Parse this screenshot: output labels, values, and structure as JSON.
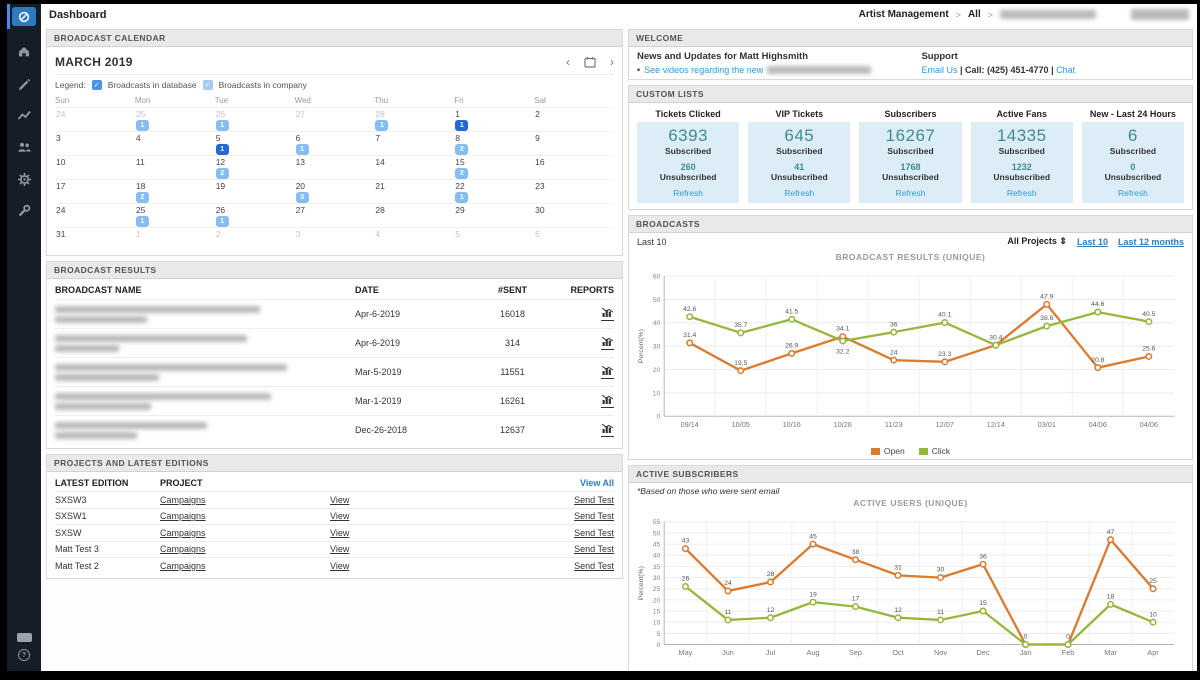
{
  "app": {
    "title": "Dashboard",
    "breadcrumb": [
      "Artist Management",
      "All"
    ]
  },
  "icons": {
    "crumb_sep": ">",
    "prev": "‹",
    "next": "›",
    "sort": "⇕",
    "bullet": "•",
    "check": "✓",
    "help": "?"
  },
  "sidebar": {
    "items": [
      "home",
      "edit",
      "reports",
      "users",
      "settings",
      "tools"
    ]
  },
  "calendar": {
    "header": "BROADCAST CALENDAR",
    "month": "MARCH 2019",
    "legend_label": "Legend:",
    "legend": [
      {
        "label": "Broadcasts in database"
      },
      {
        "label": "Broadcasts in company"
      }
    ],
    "day_names": [
      "Sun",
      "Mon",
      "Tue",
      "Wed",
      "Thu",
      "Fri",
      "Sat"
    ],
    "weeks": [
      [
        {
          "d": 24,
          "m": 1
        },
        {
          "d": 25,
          "m": 1,
          "b": 1
        },
        {
          "d": 26,
          "m": 1,
          "b": 1
        },
        {
          "d": 27,
          "m": 1
        },
        {
          "d": 28,
          "m": 1,
          "b": 1
        },
        {
          "d": 1,
          "b": 1,
          "dk": 1
        },
        {
          "d": 2
        }
      ],
      [
        {
          "d": 3
        },
        {
          "d": 4
        },
        {
          "d": 5,
          "b": 1,
          "dk": 1
        },
        {
          "d": 6,
          "b": 1
        },
        {
          "d": 7
        },
        {
          "d": 8,
          "b": 2
        },
        {
          "d": 9
        }
      ],
      [
        {
          "d": 10
        },
        {
          "d": 11
        },
        {
          "d": 12,
          "b": 2
        },
        {
          "d": 13
        },
        {
          "d": 14
        },
        {
          "d": 15,
          "b": 2
        },
        {
          "d": 16
        }
      ],
      [
        {
          "d": 17
        },
        {
          "d": 18,
          "b": 2
        },
        {
          "d": 19
        },
        {
          "d": 20,
          "b": 3
        },
        {
          "d": 21
        },
        {
          "d": 22,
          "b": 1
        },
        {
          "d": 23
        }
      ],
      [
        {
          "d": 24
        },
        {
          "d": 25,
          "b": 1
        },
        {
          "d": 26,
          "b": 1
        },
        {
          "d": 27
        },
        {
          "d": 28
        },
        {
          "d": 29
        },
        {
          "d": 30
        }
      ],
      [
        {
          "d": 31
        },
        {
          "d": 1,
          "m": 1
        },
        {
          "d": 2,
          "m": 1
        },
        {
          "d": 3,
          "m": 1
        },
        {
          "d": 4,
          "m": 1
        },
        {
          "d": 5,
          "m": 1
        },
        {
          "d": 6,
          "m": 1
        }
      ]
    ]
  },
  "broadcast_results": {
    "header": "BROADCAST RESULTS",
    "columns": [
      "BROADCAST NAME",
      "DATE",
      "#SENT",
      "REPORTS"
    ],
    "rows": [
      {
        "date": "Apr-6-2019",
        "sent": "16018"
      },
      {
        "date": "Apr-6-2019",
        "sent": "314"
      },
      {
        "date": "Mar-5-2019",
        "sent": "11551"
      },
      {
        "date": "Mar-1-2019",
        "sent": "16261"
      },
      {
        "date": "Dec-26-2018",
        "sent": "12637"
      }
    ]
  },
  "projects": {
    "header": "PROJECTS AND LATEST EDITIONS",
    "view_all": "View All",
    "columns": [
      "LATEST EDITION",
      "PROJECT"
    ],
    "rows": [
      {
        "edition": "SXSW3",
        "project": "Campaigns",
        "view": "View",
        "send": "Send Test"
      },
      {
        "edition": "SXSW1",
        "project": "Campaigns",
        "view": "View",
        "send": "Send Test"
      },
      {
        "edition": "SXSW",
        "project": "Campaigns",
        "view": "View",
        "send": "Send Test"
      },
      {
        "edition": "Matt Test 3",
        "project": "Campaigns",
        "view": "View",
        "send": "Send Test"
      },
      {
        "edition": "Matt Test 2",
        "project": "Campaigns",
        "view": "View",
        "send": "Send Test"
      }
    ]
  },
  "welcome": {
    "header": "WELCOME",
    "news_title": "News and Updates for Matt Highsmith",
    "news_link": "See videos regarding the new",
    "support_title": "Support",
    "email": "Email Us",
    "call": "Call: (425) 451-4770",
    "chat": "Chat",
    "sep": "|"
  },
  "custom_lists": {
    "header": "CUSTOM LISTS",
    "subscribed_label": "Subscribed",
    "unsubscribed_label": "Unsubscribed",
    "refresh_label": "Refresh",
    "cards": [
      {
        "title": "Tickets Clicked",
        "subscribed": "6393",
        "unsubscribed": "260"
      },
      {
        "title": "VIP Tickets",
        "subscribed": "645",
        "unsubscribed": "41"
      },
      {
        "title": "Subscribers",
        "subscribed": "16267",
        "unsubscribed": "1768"
      },
      {
        "title": "Active Fans",
        "subscribed": "14335",
        "unsubscribed": "1232"
      },
      {
        "title": "New - Last 24 Hours",
        "subscribed": "6",
        "unsubscribed": "0"
      }
    ]
  },
  "broadcasts_panel": {
    "header": "BROADCASTS",
    "range_label": "Last 10",
    "filter_label": "All Projects",
    "links": [
      "Last 10",
      "Last 12 months"
    ]
  },
  "active_subscribers": {
    "header": "ACTIVE SUBSCRIBERS",
    "note": "*Based on those who were sent email"
  },
  "chart_data": [
    {
      "type": "line",
      "title": "BROADCAST RESULTS (UNIQUE)",
      "ylabel": "Percent(%)",
      "ylim": [
        0,
        60
      ],
      "ytick": 10,
      "grid": true,
      "legend_position": "bottom",
      "x": [
        "09/14",
        "10/05",
        "10/16",
        "10/26",
        "11/23",
        "12/07",
        "12/14",
        "03/01",
        "04/06",
        "04/06"
      ],
      "series": [
        {
          "name": "Open",
          "color": "#dc7b2d",
          "values": [
            31.4,
            19.5,
            26.9,
            34.1,
            24,
            23.3,
            30.4,
            47.9,
            20.8,
            25.6
          ]
        },
        {
          "name": "Click",
          "color": "#95b83c",
          "values": [
            42.6,
            35.7,
            41.5,
            32.2,
            36,
            40.1,
            30.4,
            38.6,
            44.6,
            40.5
          ]
        }
      ]
    },
    {
      "type": "line",
      "title": "ACTIVE USERS (UNIQUE)",
      "ylabel": "Percent(%)",
      "ylim": [
        0,
        55
      ],
      "ytick": 5,
      "grid": true,
      "legend_position": "bottom",
      "x": [
        "May",
        "Jun",
        "Jul",
        "Aug",
        "Sep",
        "Oct",
        "Nov",
        "Dec",
        "Jan",
        "Feb",
        "Mar",
        "Apr"
      ],
      "series": [
        {
          "name": "Open",
          "color": "#dc7b2d",
          "values": [
            43,
            24,
            28,
            45,
            38,
            31,
            30,
            36,
            0,
            0,
            47,
            25
          ]
        },
        {
          "name": "Click",
          "color": "#95b83c",
          "values": [
            26,
            11,
            12,
            19,
            17,
            12,
            11,
            15,
            0,
            0,
            18,
            10
          ]
        }
      ]
    }
  ]
}
